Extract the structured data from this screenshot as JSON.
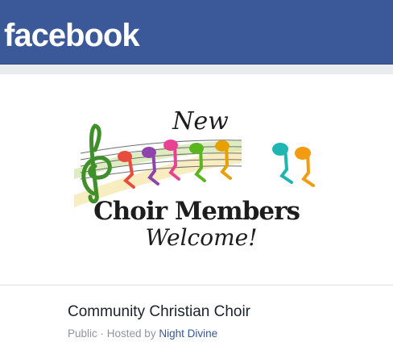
{
  "header": {
    "logo_text": "facebook",
    "brand_color": "#3b5998"
  },
  "cover": {
    "line1": "New",
    "line2": "Choir Members",
    "line3": "Welcome!"
  },
  "event": {
    "title": "Community Christian Choir",
    "privacy": "Public",
    "separator": " · ",
    "hosted_by_label": "Hosted by ",
    "host_name": "Night Divine"
  }
}
